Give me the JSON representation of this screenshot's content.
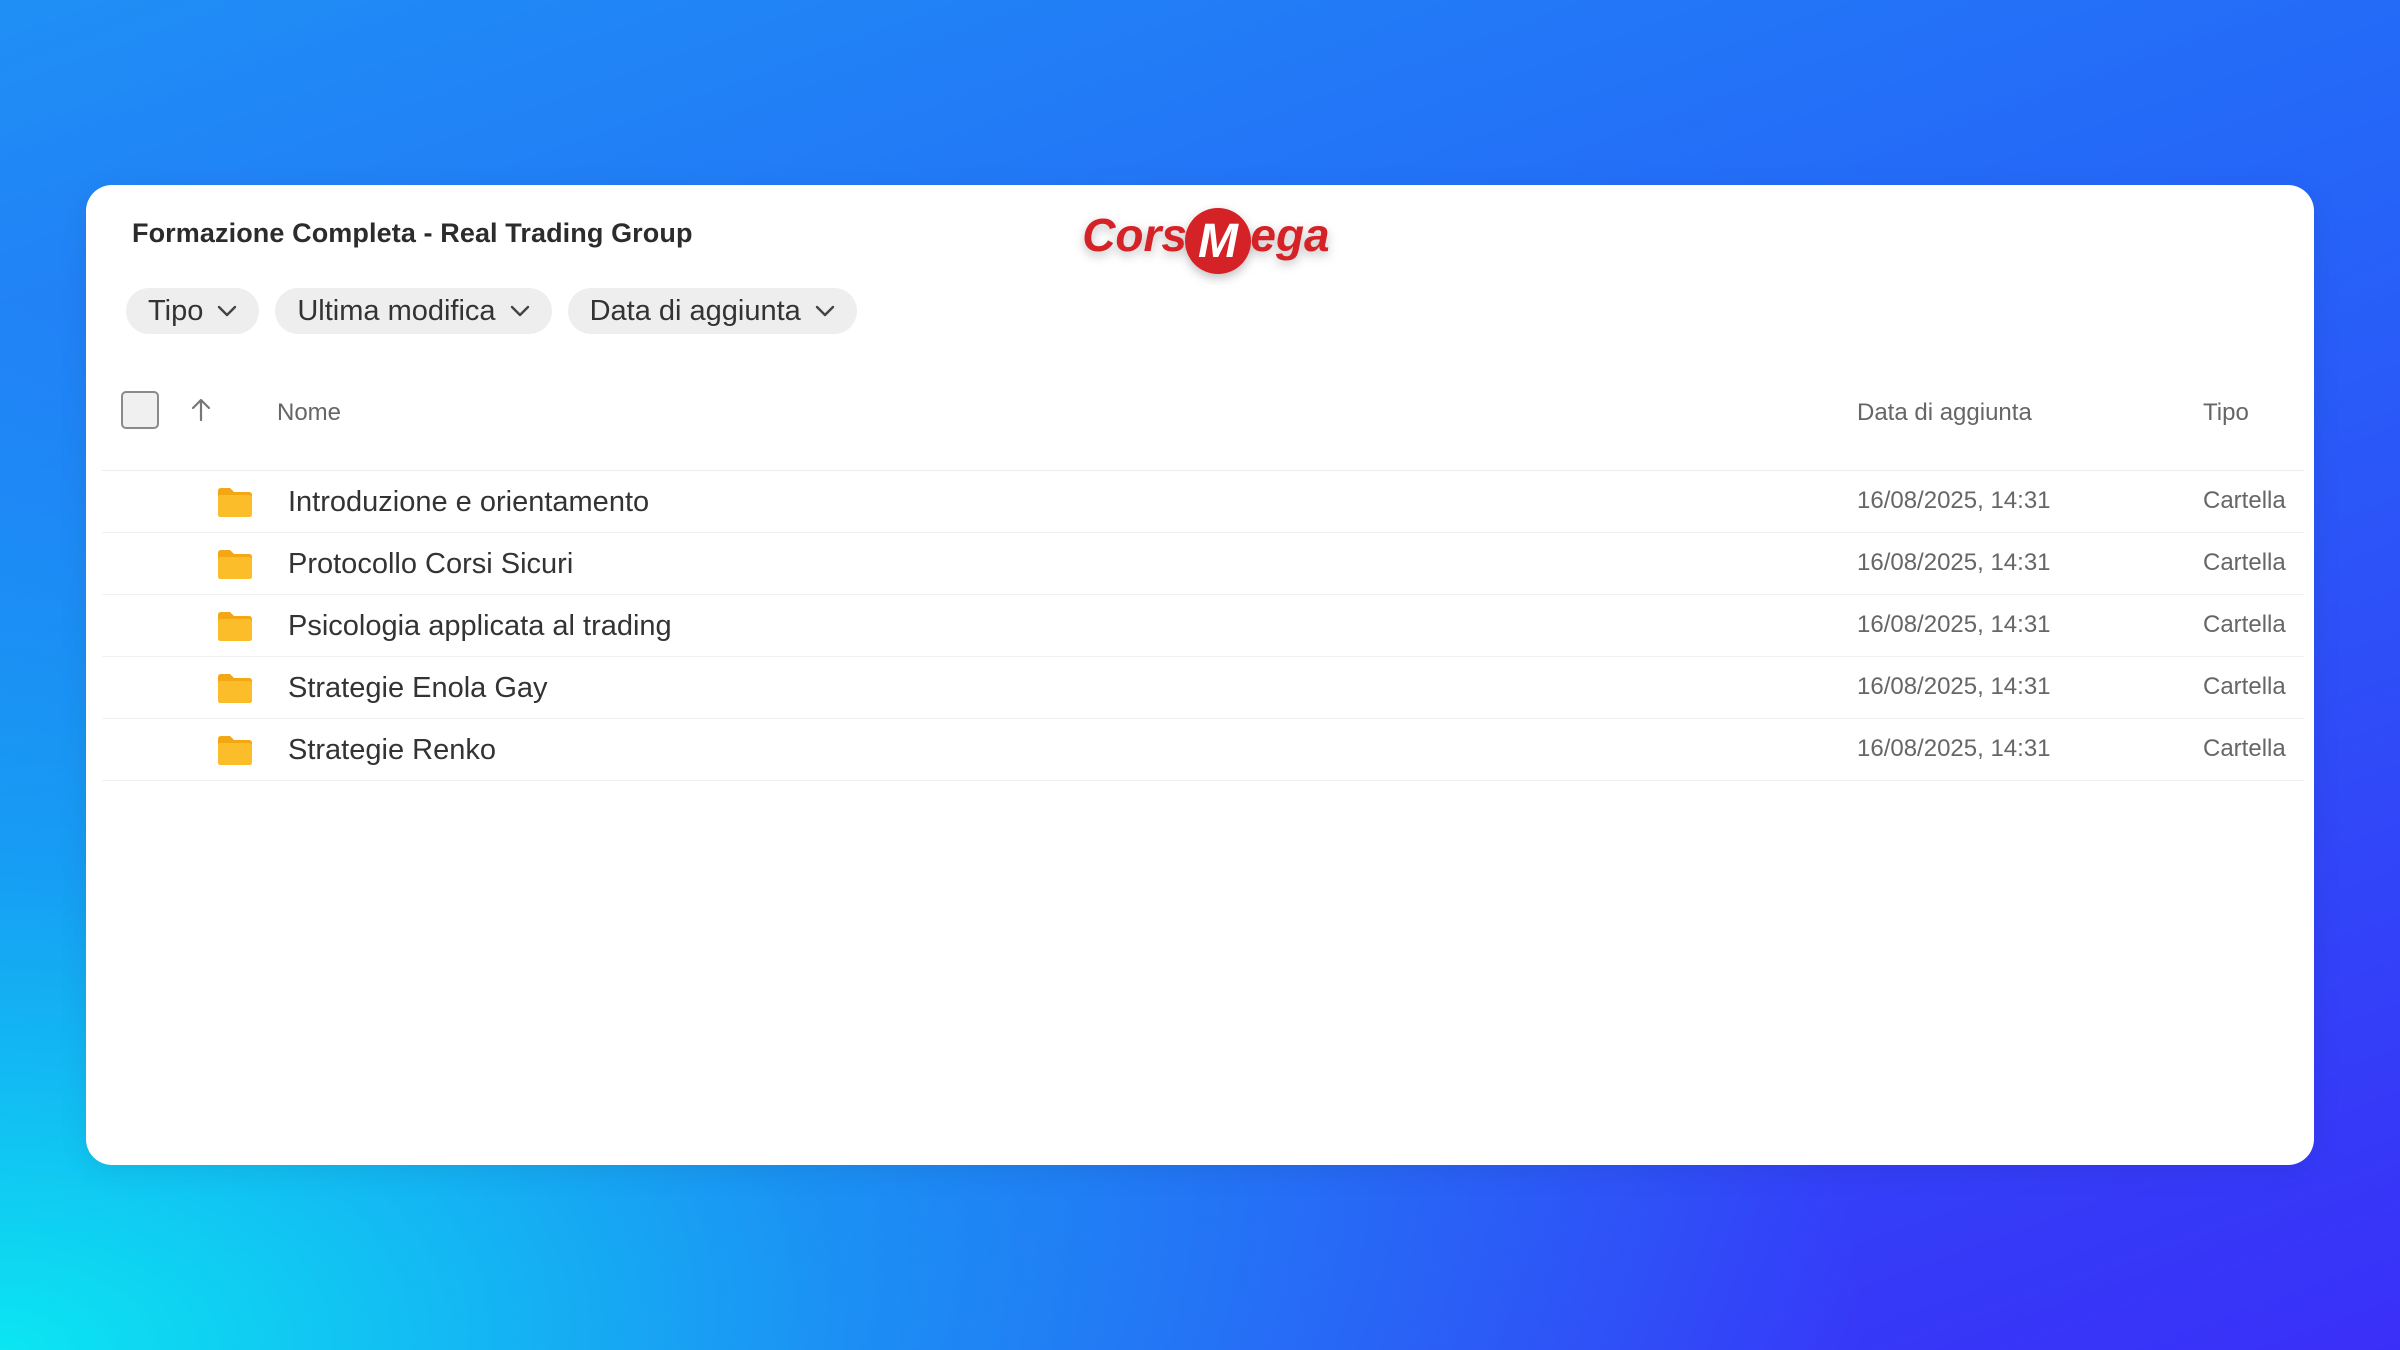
{
  "window": {
    "title": "Formazione Completa - Real Trading Group"
  },
  "logo": {
    "part1": "Corsi",
    "part2_initial": "M",
    "part2_rest": "ega",
    "color": "#d42027"
  },
  "filters": [
    {
      "label": "Tipo",
      "icon": "chevron-down-icon"
    },
    {
      "label": "Ultima modifica",
      "icon": "chevron-down-icon"
    },
    {
      "label": "Data di aggiunta",
      "icon": "chevron-down-icon"
    }
  ],
  "table": {
    "columns": {
      "name": "Nome",
      "date_added": "Data di aggiunta",
      "type": "Tipo"
    },
    "sort_icon": "arrow-up-icon",
    "rows": [
      {
        "name": "Introduzione e orientamento",
        "date": "16/08/2025, 14:31",
        "type": "Cartella",
        "icon": "folder-icon"
      },
      {
        "name": "Protocollo Corsi Sicuri",
        "date": "16/08/2025, 14:31",
        "type": "Cartella",
        "icon": "folder-icon"
      },
      {
        "name": "Psicologia applicata al trading",
        "date": "16/08/2025, 14:31",
        "type": "Cartella",
        "icon": "folder-icon"
      },
      {
        "name": "Strategie Enola Gay",
        "date": "16/08/2025, 14:31",
        "type": "Cartella",
        "icon": "folder-icon"
      },
      {
        "name": "Strategie Renko",
        "date": "16/08/2025, 14:31",
        "type": "Cartella",
        "icon": "folder-icon"
      }
    ]
  },
  "colors": {
    "folder": "#fbbd2a",
    "folder_tab": "#f3a712",
    "text_primary": "#333333",
    "text_secondary": "#666666",
    "chip_bg": "#eeeeee"
  }
}
